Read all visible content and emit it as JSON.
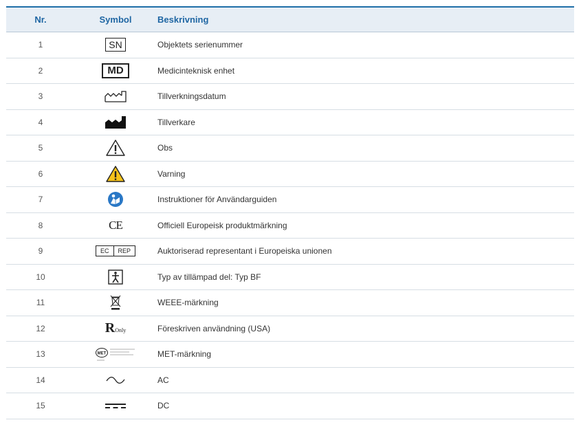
{
  "header": {
    "nr": "Nr.",
    "symbol": "Symbol",
    "description": "Beskrivning"
  },
  "rows": [
    {
      "nr": "1",
      "icon": "serial-number-icon",
      "symbol_text": "SN",
      "description": "Objektets serienummer"
    },
    {
      "nr": "2",
      "icon": "medical-device-icon",
      "symbol_text": "MD",
      "description": "Medicinteknisk enhet"
    },
    {
      "nr": "3",
      "icon": "date-of-manufacture-icon",
      "description": "Tillverkningsdatum"
    },
    {
      "nr": "4",
      "icon": "manufacturer-icon",
      "description": "Tillverkare"
    },
    {
      "nr": "5",
      "icon": "caution-icon",
      "description": "Obs"
    },
    {
      "nr": "6",
      "icon": "warning-icon",
      "description": "Varning"
    },
    {
      "nr": "7",
      "icon": "instructions-icon",
      "description": "Instruktioner för Användarguiden"
    },
    {
      "nr": "8",
      "icon": "ce-marking-icon",
      "symbol_text": "CE",
      "description": "Officiell Europeisk produktmärkning"
    },
    {
      "nr": "9",
      "icon": "ec-rep-icon",
      "symbol_text_a": "EC",
      "symbol_text_b": "REP",
      "description": "Auktoriserad representant i Europeiska unionen"
    },
    {
      "nr": "10",
      "icon": "type-bf-icon",
      "description": "Typ av tillämpad del: Typ BF"
    },
    {
      "nr": "11",
      "icon": "weee-icon",
      "description": "WEEE-märkning"
    },
    {
      "nr": "12",
      "icon": "rx-only-icon",
      "symbol_text": "R",
      "symbol_small": "Only",
      "description": "Föreskriven användning (USA)"
    },
    {
      "nr": "13",
      "icon": "met-mark-icon",
      "symbol_text": "MET",
      "description": "MET-märkning"
    },
    {
      "nr": "14",
      "icon": "ac-icon",
      "description": "AC"
    },
    {
      "nr": "15",
      "icon": "dc-icon",
      "description": "DC"
    }
  ],
  "colors": {
    "header_text": "#1f66a3",
    "header_bg": "#e7eef5",
    "warning_yellow": "#f6c21a",
    "instructions_blue": "#2a78c6"
  }
}
